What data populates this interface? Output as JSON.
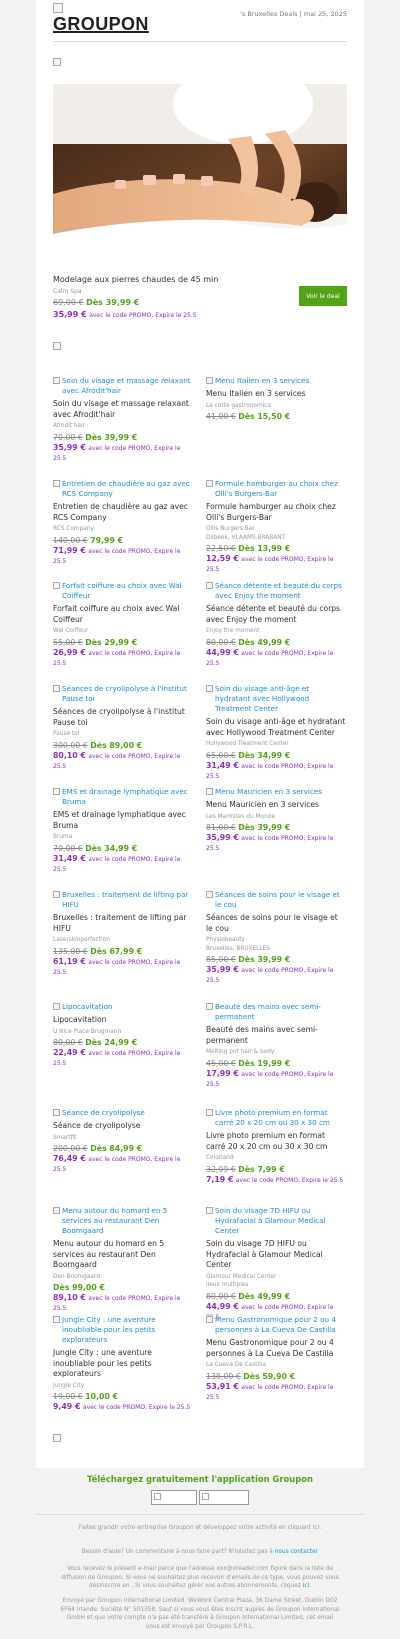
{
  "header": {
    "logo": "GROUPON",
    "meta": "'s Bruxelles Deals | mai 25, 2025"
  },
  "hero": {
    "title": "Modelage aux pierres chaudes de 45 min",
    "merchant": "Calm Spa",
    "old_price": "69,00 €",
    "price": "Dès 39,99 €",
    "promo_price": "35,99 €",
    "promo_text": "avec le code PROMO, Expire le 25.5",
    "cta": "Voir le deal"
  },
  "deals": [
    {
      "img_alt": "Soin du visage et massage relaxant avec Afrodit'hair",
      "title": "Soin du visage et massage relaxant avec Afrodit'hair",
      "merchant": "Afrodit'hair",
      "location": "",
      "old_price": "70,00 €",
      "price": "Dès 39,99 €",
      "promo_price": "35,99 €",
      "promo_text": "avec le code PROMO, Expire le 25.5"
    },
    {
      "img_alt": "Menu Italien en 3 services",
      "title": "Menu Italien en 3 services",
      "merchant": "La corte gastronomica",
      "location": "",
      "old_price": "41,00 €",
      "price": "Dès 15,50 €",
      "promo_price": "",
      "promo_text": ""
    },
    {
      "img_alt": "Entretien de chaudière au gaz avec RCS Company",
      "title": "Entretien de chaudière au gaz avec RCS Company",
      "merchant": "RCS Company",
      "location": "",
      "old_price": "140,00 €",
      "price": "79,99 €",
      "promo_price": "71,99 €",
      "promo_text": "avec le code PROMO, Expire le 25.5"
    },
    {
      "img_alt": "Formule hamburger au choix chez Olli's Burgers-Bar",
      "title": "Formule hamburger au choix chez Olli's Burgers-Bar",
      "merchant": "Ollis Burgers Bar",
      "location": "Dilbeek, VLAAMS-BRABANT",
      "old_price": "22,50 €",
      "price": "Dès 13,99 €",
      "promo_price": "12,59 €",
      "promo_text": "avec le code PROMO, Expire le 25.5"
    },
    {
      "img_alt": "Forfait coiffure au choix avec Wal Coiffeur",
      "title": "Forfait coiffure au choix avec Wal Coiffeur",
      "merchant": "Wal Coiffeur",
      "location": "",
      "old_price": "55,00 €",
      "price": "Dès 29,99 €",
      "promo_price": "26,99 €",
      "promo_text": "avec le code PROMO, Expire le 25.5"
    },
    {
      "img_alt": "Séance détente et beauté du corps avec Enjoy the moment",
      "title": "Séance détente et beauté du corps avec Enjoy the moment",
      "merchant": "Enjoy the moment",
      "location": "",
      "old_price": "80,00 €",
      "price": "Dès 49,99 €",
      "promo_price": "44,99 €",
      "promo_text": "avec le code PROMO, Expire le 25.5"
    },
    {
      "img_alt": "Séances de cryolipolyse à l'institut Pause toi",
      "title": "Séances de cryolipolyse à l'institut Pause toi",
      "merchant": "Pause toi",
      "location": "",
      "old_price": "300,00 €",
      "price": "Dès 89,00 €",
      "promo_price": "80,10 €",
      "promo_text": "avec le code PROMO, Expire le 25.5"
    },
    {
      "img_alt": "Soin du visage anti-âge et hydratant avec Hollywood Treatment Center",
      "title": "Soin du visage anti-âge et hydratant avec Hollywood Treatment Center",
      "merchant": "Hollywood Treatment Center",
      "location": "",
      "old_price": "65,00 €",
      "price": "Dès 34,99 €",
      "promo_price": "31,49 €",
      "promo_text": "avec le code PROMO, Expire le 25.5"
    },
    {
      "img_alt": "EMS et drainage lymphatique avec Bruma",
      "title": "EMS et drainage lymphatique avec Bruma",
      "merchant": "Bruma",
      "location": "",
      "old_price": "70,00 €",
      "price": "Dès 34,99 €",
      "promo_price": "31,49 €",
      "promo_text": "avec le code PROMO, Expire le 25.5"
    },
    {
      "img_alt": "Menu Mauricien en 3 services",
      "title": "Menu Mauricien en 3 services",
      "merchant": "Les Marmites du Monde",
      "location": "",
      "old_price": "81,00 €",
      "price": "Dès 39,99 €",
      "promo_price": "35,99 €",
      "promo_text": "avec le code PROMO, Expire le 25.5"
    },
    {
      "img_alt": "Bruxelles : traitement de lifting par HIFU",
      "title": "Bruxelles : traitement de lifting par HIFU",
      "merchant": "Laserskinperfection",
      "location": "",
      "old_price": "135,00 €",
      "price": "Dès 67,99 €",
      "promo_price": "61,19 €",
      "promo_text": "avec le code PROMO, Expire le 25.5"
    },
    {
      "img_alt": "Séances de soins pour le visage et le cou",
      "title": "Séances de soins pour le visage et le cou",
      "merchant": "Physiobeauty",
      "location": "Bruxelles, BRUXELLES",
      "old_price": "85,00 €",
      "price": "Dès 39,99 €",
      "promo_price": "35,99 €",
      "promo_text": "avec le code PROMO, Expire le 25.5"
    },
    {
      "img_alt": "Lipocavitation",
      "title": "Lipocavitation",
      "merchant": "U Nice Place Brugmann",
      "location": "",
      "old_price": "80,00 €",
      "price": "Dès 24,99 €",
      "promo_price": "22,49 €",
      "promo_text": "avec le code PROMO, Expire le 25.5"
    },
    {
      "img_alt": "Beauté des mains avec semi-permanent",
      "title": "Beauté des mains avec semi-permanent",
      "merchant": "Melting pot hair & body",
      "location": "",
      "old_price": "45,00 €",
      "price": "Dès 19,99 €",
      "promo_price": "17,99 €",
      "promo_text": "avec le code PROMO, Expire le 25.5"
    },
    {
      "img_alt": "Séance de cryolipolyse",
      "title": "Séance de cryolipolyse",
      "merchant": "Smartfit",
      "location": "",
      "old_price": "200,00 €",
      "price": "Dès 84,99 €",
      "promo_price": "76,49 €",
      "promo_text": "avec le code PROMO, Expire le 25.5"
    },
    {
      "img_alt": "Livre photo premium en format carré 20 x 20 cm ou 30 x 30 cm",
      "title": "Livre photo premium en format carré 20 x 20 cm ou 30 x 30 cm",
      "merchant": "Colorland",
      "location": "",
      "old_price": "32,99 €",
      "price": "Dès 7,99 €",
      "promo_price": "7,19 €",
      "promo_text": "avec le code PROMO, Expire le 25.5"
    },
    {
      "img_alt": "Menu autour du homard en 5 services au restaurant Den Boomgaard",
      "title": "Menu autour du homard en 5 services au restaurant Den Boomgaard",
      "merchant": "Den Boomgaard",
      "location": "",
      "old_price": "",
      "price": "Dès 99,00 €",
      "promo_price": "89,10 €",
      "promo_text": "avec le code PROMO, Expire le 25.5"
    },
    {
      "img_alt": "Soin du visage 7D HIFU ou Hydrafacial à Glamour Medical Center",
      "title": "Soin du visage 7D HIFU ou Hydrafacial à Glamour Medical Center",
      "merchant": "Glamour Medical Center",
      "location": "lieux multiples",
      "old_price": "80,00 €",
      "price": "Dès 49,99 €",
      "promo_price": "44,99 €",
      "promo_text": "avec le code PROMO, Expire le 25.5"
    },
    {
      "img_alt": "Jungle City : une aventure inoubliable pour les petits explorateurs",
      "title": "Jungle City : une aventure inoubliable pour les petits explorateurs",
      "merchant": "Jungle City",
      "location": "",
      "old_price": "19,00 €",
      "price": "10,00 €",
      "promo_price": "9,49 €",
      "promo_text": "avec le code PROMO, Expire le 25.5"
    },
    {
      "img_alt": "Menu Gastronomique pour 2 ou 4 personnes à La Cueva De Castilla",
      "title": "Menu Gastronomique pour 2 ou 4 personnes à La Cueva De Castilla",
      "merchant": "La Cueva De Castilla",
      "location": "",
      "old_price": "138,00 €",
      "price": "Dès 59,90 €",
      "promo_price": "53,91 €",
      "promo_text": "avec le code PROMO, Expire le 25.5"
    }
  ],
  "footer": {
    "app_title": "Téléchargez gratuitement l'application Groupon",
    "line1": "Faites grandir votre entreprise Groupon et développez votre activité en cliquant ici.",
    "help_text": "Besoin d'aide? Un commentaire à nous faire part? N'hésitez pas à",
    "help_link": "nous contacter",
    "legal1": "Vous recevez le présent e-mail parce que l'adresse xxx@xreader.com figure dans la liste de diffusion de Groupon. Si vous ne souhaitez plus recevoir d'emails de ce type, vous pouvez vous désinscrire en . Si vous souhaitez gérer vos autres abonnements, cliquez",
    "legal1_link": "ici",
    "legal2": "Envoyé par Groupon International Limited, WeWork Central Plaza, 36 Dame Street, Dublin D02 EF64 Irlande. Société N° 501358. Sauf si vous vous êtes inscrit auprès de Groupon International GmbH et que votre compte n'a pas été transféré à Groupon International Limited, cet email vous est envoyé par Groupon S.P.R.L."
  },
  "colors": {
    "accent_green": "#53a318",
    "promo_purple": "#8e2ec0",
    "link_blue": "#1a8fd9"
  }
}
